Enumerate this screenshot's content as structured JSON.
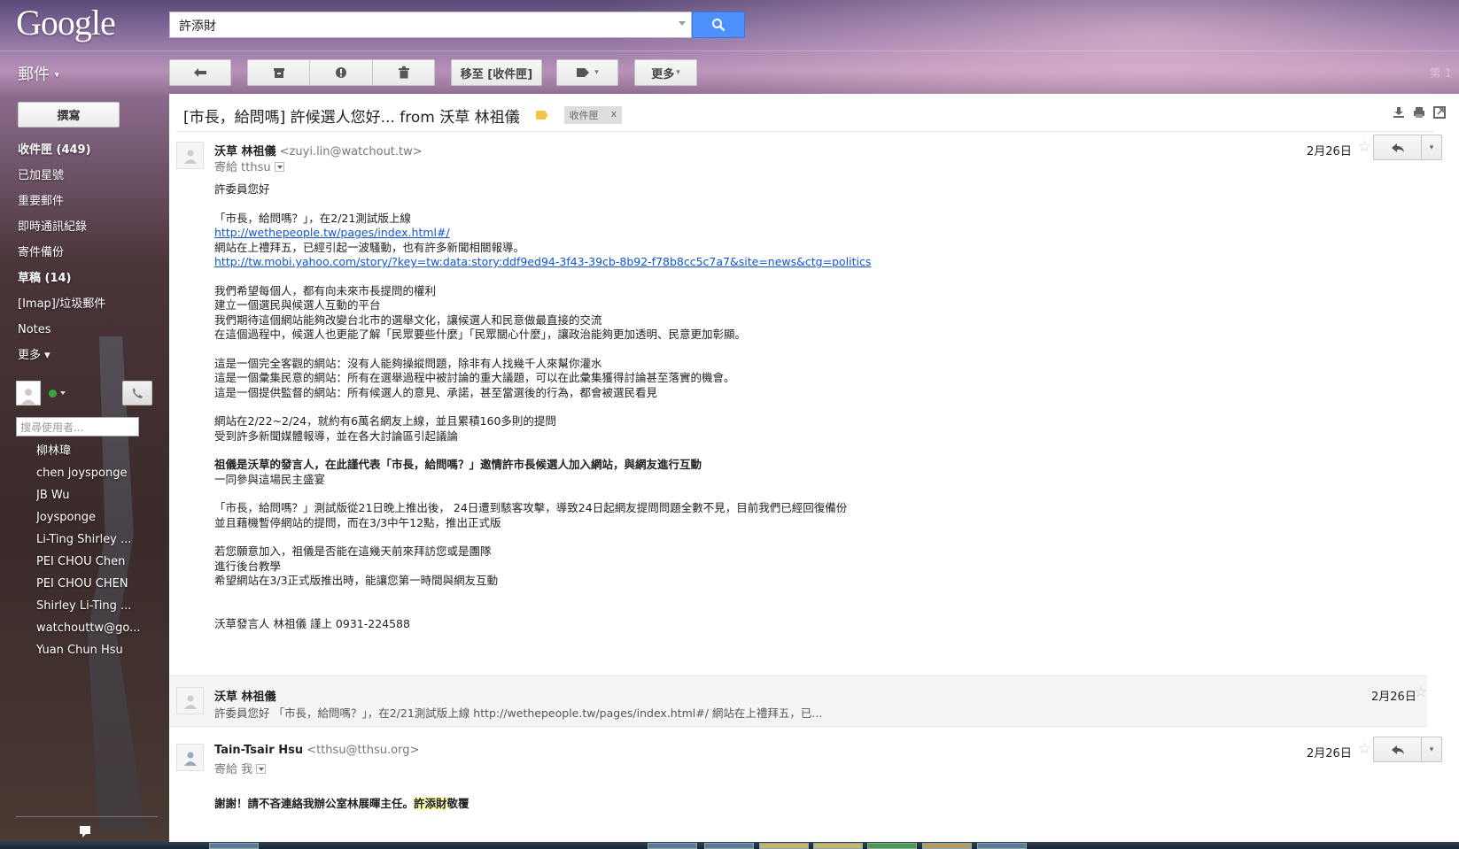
{
  "app": {
    "logo": "Google",
    "mail_label": "郵件",
    "right_faint_text": "第 1"
  },
  "search": {
    "value": "許添財"
  },
  "toolbar": {
    "move_to_inbox": "移至 [收件匣]",
    "more": "更多"
  },
  "compose": "撰寫",
  "nav": [
    {
      "label": "收件匣 (449)",
      "bold": true
    },
    {
      "label": "已加星號",
      "bold": false
    },
    {
      "label": "重要郵件",
      "bold": false
    },
    {
      "label": "即時通訊紀錄",
      "bold": false
    },
    {
      "label": "寄件備份",
      "bold": false
    },
    {
      "label": "草稿 (14)",
      "bold": true
    },
    {
      "label": "[Imap]/垃圾郵件",
      "bold": false
    },
    {
      "label": "Notes",
      "bold": false
    },
    {
      "label": "更多 ▾",
      "bold": false
    }
  ],
  "chat": {
    "search_placeholder": "搜尋使用者...",
    "contacts": [
      "柳林瑋",
      "chen joysponge",
      "JB Wu",
      "Joysponge",
      "Li-Ting Shirley ...",
      "PEI CHOU Chen",
      "PEI CHOU CHEN",
      "Shirley Li-Ting ...",
      "watchouttw@go...",
      "Yuan Chun Hsu"
    ]
  },
  "thread": {
    "subject": "[市長，給問嗎] 許候選人您好... from 沃草 林祖儀",
    "label_chip": "收件匣",
    "label_chip_close": "x",
    "messages": [
      {
        "sender_name": "沃草 林祖儀",
        "sender_email": "<zuyi.lin@watchout.tw>",
        "to": "寄給 tthsu",
        "date": "2月26日",
        "body": [
          "許委員您好",
          "",
          "「市長，給問嗎？」，在2/21測試版上線",
          "http://wethepeople.tw/pages/index.html#/",
          "網站在上禮拜五，已經引起一波騷動，也有許多新聞相關報導。",
          "http://tw.mobi.yahoo.com/story/?key=tw:data:story:ddf9ed94-3f43-39cb-8b92-f78b8cc5c7a7&site=news&ctg=politics",
          "",
          "我們希望每個人，都有向未來市長提問的權利",
          "建立一個選民與候選人互動的平台",
          "我們期待這個網站能夠改變台北市的選舉文化，讓候選人和民意做最直接的交流",
          "在這個過程中，候選人也更能了解「民眾要些什麼」「民眾關心什麼」，讓政治能夠更加透明、民意更加彰顯。",
          "",
          "這是一個完全客觀的網站：沒有人能夠操縱問題，除非有人找幾千人來幫你灌水",
          "這是一個彙集民意的網站：所有在選舉過程中被討論的重大議題，可以在此彙集獲得討論甚至落實的機會。",
          "這是一個提供監督的網站：所有候選人的意見、承諾，甚至當選後的行為，都會被選民看見",
          "",
          "網站在2/22~2/24，就約有6萬名網友上線，並且累積160多則的提問",
          "受到許多新聞媒體報導，並在各大討論區引起議論",
          "",
          "祖儀是沃草的發言人，在此謹代表「市長，給問嗎？」邀情許市長候選人加入網站，與網友進行互動",
          "一同參與這場民主盛宴",
          "",
          "「市長，給問嗎？」測試版從21日晚上推出後， 24日遭到駭客攻擊，導致24日起網友提問問題全數不見，目前我們已經回復備份",
          "並且藉機暫停網站的提問，而在3/3中午12點，推出正式版",
          "",
          "若您願意加入，祖儀是否能在這幾天前來拜訪您或是團隊",
          "進行後台教學",
          "希望網站在3/3正式版推出時，能讓您第一時間與網友互動",
          "",
          "",
          "沃草發言人 林祖儀 謹上 0931-224588"
        ]
      },
      {
        "sender_name": "沃草 林祖儀",
        "date": "2月26日",
        "snippet": "許委員您好 「市長，給問嗎？」，在2/21測試版上線 http://wethepeople.tw/pages/index.html#/ 網站在上禮拜五，已..."
      },
      {
        "sender_name": "Tain-Tsair Hsu",
        "sender_email": "<tthsu@tthsu.org>",
        "to": "寄給 我",
        "date": "2月26日",
        "body_prefix": "謝謝！請不吝連絡我辦公室林展暉主任。",
        "body_highlight": "許添財",
        "body_suffix": "敬覆"
      }
    ]
  },
  "icons": {
    "reply": "reply-icon",
    "archive": "archive-icon",
    "spam": "report-spam-icon",
    "delete": "trash-icon",
    "label": "label-icon",
    "search": "magnifier-icon"
  },
  "colors": {
    "search_button": "#4d90fe",
    "link": "#1155cc",
    "label_tag": "#f4c542",
    "online_status": "#3aa63a"
  }
}
